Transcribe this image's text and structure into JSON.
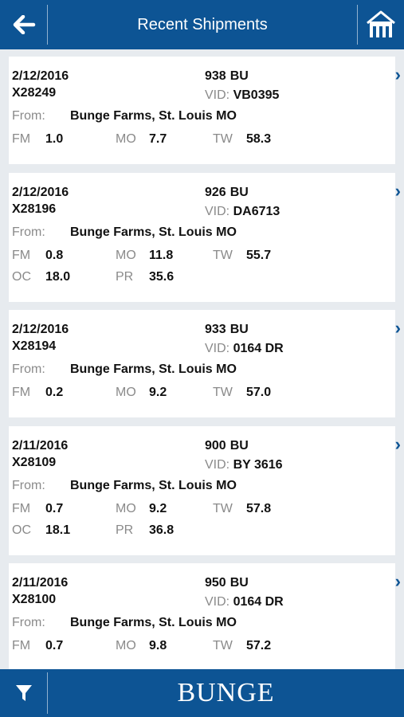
{
  "header": {
    "title": "Recent Shipments",
    "back_icon": "arrow-left-icon",
    "home_icon": "barn-icon"
  },
  "labels": {
    "from": "From:",
    "fm": "FM",
    "mo": "MO",
    "tw": "TW",
    "oc": "OC",
    "pr": "PR",
    "vid": "VID:",
    "chevron": "›"
  },
  "shipments": [
    {
      "date": "2/12/2016",
      "id": "X28249",
      "qty": "938",
      "unit": "BU",
      "vid": "VB0395",
      "from": "Bunge Farms, St. Louis MO",
      "fm": "1.0",
      "mo": "7.7",
      "tw": "58.3",
      "oc": "",
      "pr": ""
    },
    {
      "date": "2/12/2016",
      "id": "X28196",
      "qty": "926",
      "unit": "BU",
      "vid": "DA6713",
      "from": "Bunge Farms, St. Louis MO",
      "fm": "0.8",
      "mo": "11.8",
      "tw": "55.7",
      "oc": "18.0",
      "pr": "35.6"
    },
    {
      "date": "2/12/2016",
      "id": "X28194",
      "qty": "933",
      "unit": "BU",
      "vid": "0164 DR",
      "from": "Bunge Farms, St. Louis MO",
      "fm": "0.2",
      "mo": "9.2",
      "tw": "57.0",
      "oc": "",
      "pr": ""
    },
    {
      "date": "2/11/2016",
      "id": "X28109",
      "qty": "900",
      "unit": "BU",
      "vid": "BY 3616",
      "from": "Bunge Farms, St. Louis MO",
      "fm": "0.7",
      "mo": "9.2",
      "tw": "57.8",
      "oc": "18.1",
      "pr": "36.8"
    },
    {
      "date": "2/11/2016",
      "id": "X28100",
      "qty": "950",
      "unit": "BU",
      "vid": "0164 DR",
      "from": "Bunge Farms, St. Louis MO",
      "fm": "0.7",
      "mo": "9.8",
      "tw": "57.2",
      "oc": "",
      "pr": ""
    }
  ],
  "footer": {
    "logo_text": "BUNGE",
    "filter_icon": "filter-icon"
  },
  "colors": {
    "brand": "#0d5494",
    "background": "#e7ebef"
  }
}
